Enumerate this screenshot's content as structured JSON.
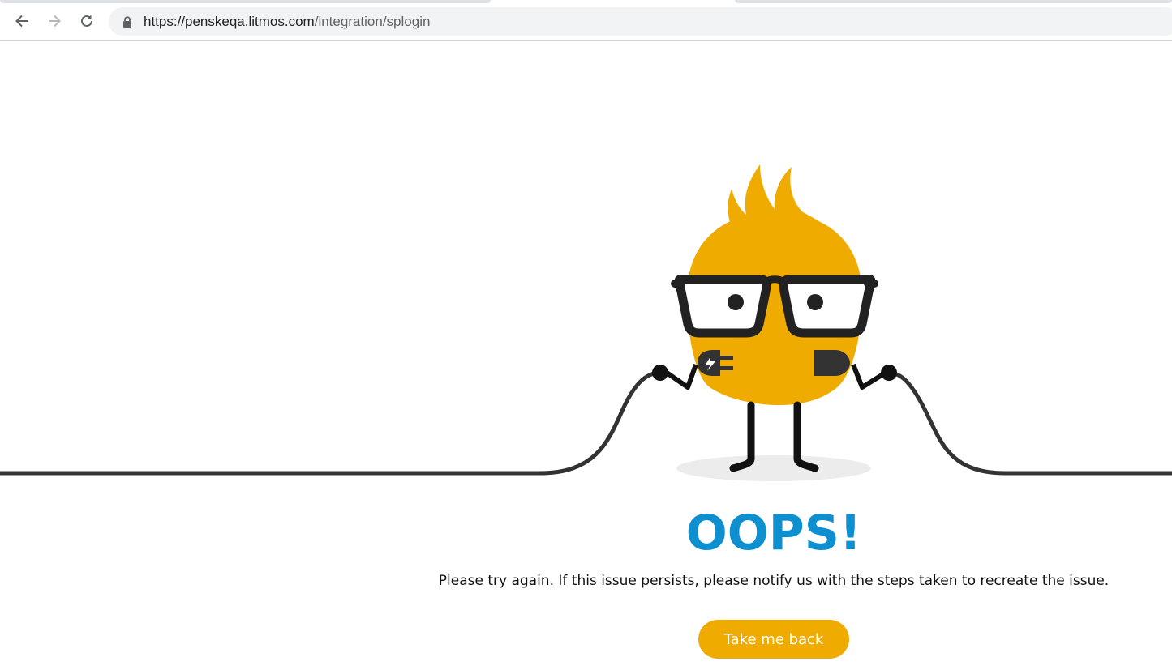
{
  "browser": {
    "url_host": "https://penskeqa.litmos.com",
    "url_path": "/integration/splogin",
    "back_icon": "arrow-left-icon",
    "forward_icon": "arrow-right-icon",
    "reload_icon": "reload-icon",
    "lock_icon": "lock-icon"
  },
  "error_page": {
    "title": "OOPS!",
    "message": "Please try again. If this issue persists, please notify us with the steps taken to recreate the issue.",
    "button_label": "Take me back",
    "illustration_icon": "unplugged-mascot-icon"
  },
  "colors": {
    "accent": "#f0ab00",
    "title": "#0e8fd0",
    "cable": "#333333"
  }
}
